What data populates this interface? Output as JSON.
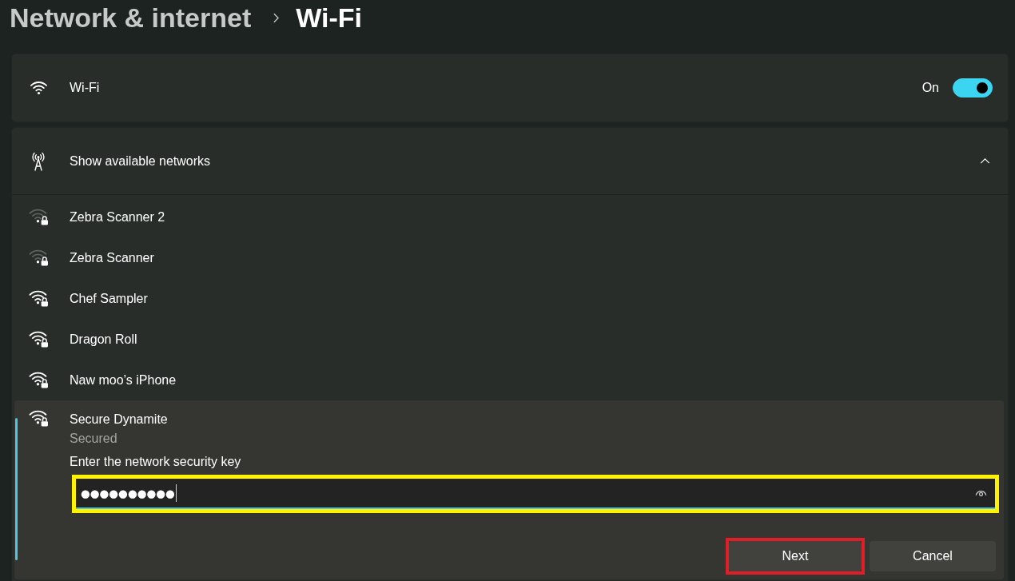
{
  "breadcrumb": {
    "parent": "Network & internet",
    "current": "Wi-Fi"
  },
  "wifi": {
    "label": "Wi-Fi",
    "state_label": "On",
    "on": true
  },
  "networks_panel": {
    "title": "Show available networks",
    "expanded": true,
    "networks": [
      {
        "name": "Zebra Scanner 2",
        "weak_signal": true,
        "secured": true,
        "selected": false
      },
      {
        "name": "Zebra Scanner",
        "weak_signal": true,
        "secured": true,
        "selected": false
      },
      {
        "name": "Chef Sampler",
        "weak_signal": false,
        "secured": true,
        "selected": false
      },
      {
        "name": "Dragon Roll",
        "weak_signal": false,
        "secured": true,
        "selected": false
      },
      {
        "name": "Naw moo’s iPhone",
        "weak_signal": false,
        "secured": true,
        "selected": false
      },
      {
        "name": "Secure Dynamite",
        "weak_signal": false,
        "secured": true,
        "selected": true,
        "status": "Secured",
        "prompt": "Enter the network security key",
        "password_field": {
          "value": "●●●●●●●●●●",
          "focused": true,
          "outlined": true
        },
        "buttons": [
          {
            "label": "Next",
            "outlined": true
          },
          {
            "label": "Cancel",
            "outlined": false
          }
        ]
      }
    ]
  }
}
